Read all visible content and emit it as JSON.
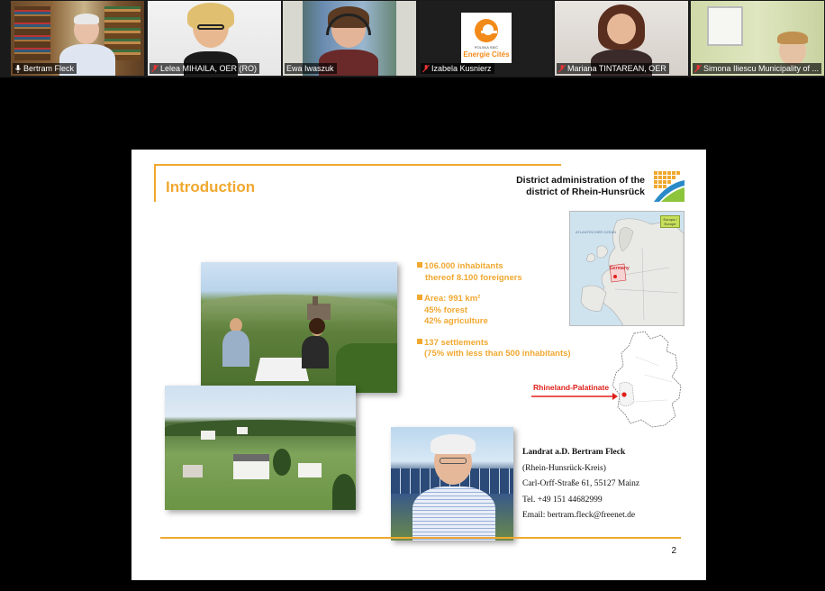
{
  "participants": [
    {
      "name": "Bertram Fleck",
      "muted": false,
      "active": true
    },
    {
      "name": "Lelea MIHAILA, OER (RO)",
      "muted": true,
      "active": false
    },
    {
      "name": "Ewa Iwaszuk",
      "muted": false,
      "active": false
    },
    {
      "name": "Izabela Kusnierz",
      "muted": true,
      "active": false
    },
    {
      "name": "Mariana TINTAREAN, OER",
      "muted": true,
      "active": false
    },
    {
      "name": "Simona Iliescu Municipality of ...",
      "muted": true,
      "active": false
    }
  ],
  "org_logo": {
    "line1": "POLSKA SIEĆ",
    "line2": "Energie Cités"
  },
  "slide": {
    "title": "Introduction",
    "district_line1": "District administration of the",
    "district_line2": "district of Rhein-Hunsrück",
    "bullets": [
      {
        "main": "106.000 inhabitants",
        "sub": [
          "thereof 8.100 foreigners"
        ]
      },
      {
        "main": "Area: 991 km²",
        "sub": [
          "45% forest",
          "42% agriculture"
        ]
      },
      {
        "main": "137 settlements",
        "sub": [
          "(75% with less than 500 inhabitants)"
        ]
      }
    ],
    "map_tag": "Europa / Europe",
    "map_label_germany": "Germany",
    "map_sea_label": "ATLANTISCHER OZEAN",
    "region_label": "Rhineland-Palatinate",
    "contact": {
      "name": "Landrat a.D. Bertram Fleck",
      "district": "(Rhein-Hunsrück-Kreis)",
      "address": "Carl-Orff-Straße 61, 55127 Mainz",
      "phone": "Tel. +49 151 44682999",
      "email": "Email: bertram.fleck@freenet.de"
    },
    "page_number": "2"
  },
  "colors": {
    "accent": "#f0a830",
    "highlight": "#e0201a",
    "active_speaker": "#e6d93a"
  }
}
